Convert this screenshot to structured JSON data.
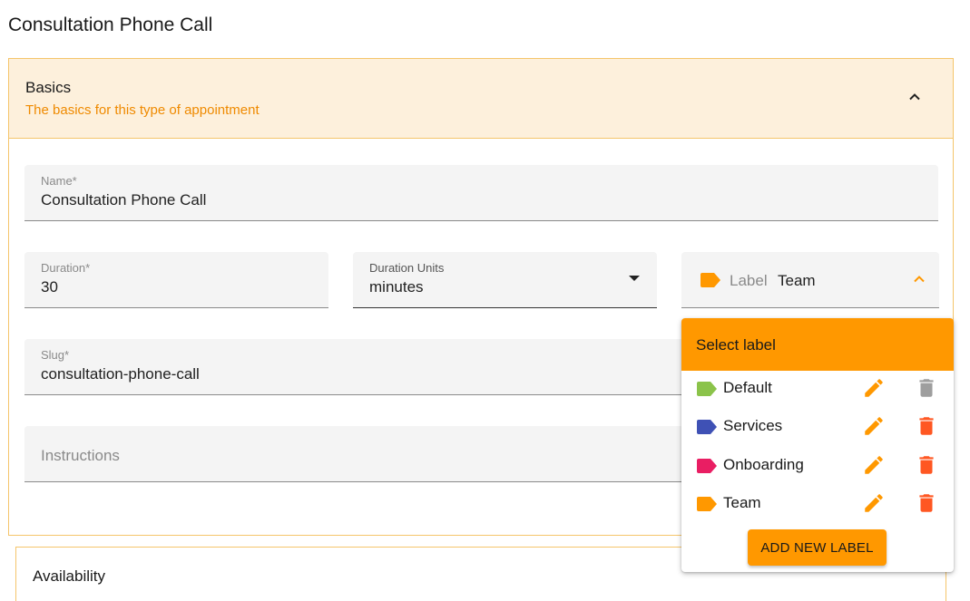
{
  "page_title": "Consultation Phone Call",
  "basics": {
    "title": "Basics",
    "subtitle": "The basics for this type of appointment",
    "collapse_icon": "chevron-up-icon"
  },
  "fields": {
    "name": {
      "label": "Name*",
      "value": "Consultation Phone Call"
    },
    "duration": {
      "label": "Duration*",
      "value": "30"
    },
    "duration_units": {
      "label": "Duration Units",
      "value": "minutes"
    },
    "slug": {
      "label": "Slug*",
      "value": "consultation-phone-call"
    },
    "instructions": {
      "placeholder": "Instructions"
    }
  },
  "label_selector": {
    "label": "Label",
    "value": "Team",
    "tag_color": "#ff9800"
  },
  "label_popup": {
    "title": "Select label",
    "labels": [
      {
        "name": "Default",
        "color": "#8bc34a",
        "delete_color": "#9e9e9e"
      },
      {
        "name": "Services",
        "color": "#3f51b5",
        "delete_color": "#ff5722"
      },
      {
        "name": "Onboarding",
        "color": "#e91e63",
        "delete_color": "#ff5722"
      },
      {
        "name": "Team",
        "color": "#ff9800",
        "delete_color": "#ff5722"
      }
    ],
    "add_button": "ADD NEW LABEL"
  },
  "availability": {
    "title": "Availability"
  },
  "colors": {
    "accent": "#ff9800",
    "panel_header_bg": "#fdf0dc",
    "panel_border": "#f5c56b",
    "edit_icon": "#ff9800"
  }
}
